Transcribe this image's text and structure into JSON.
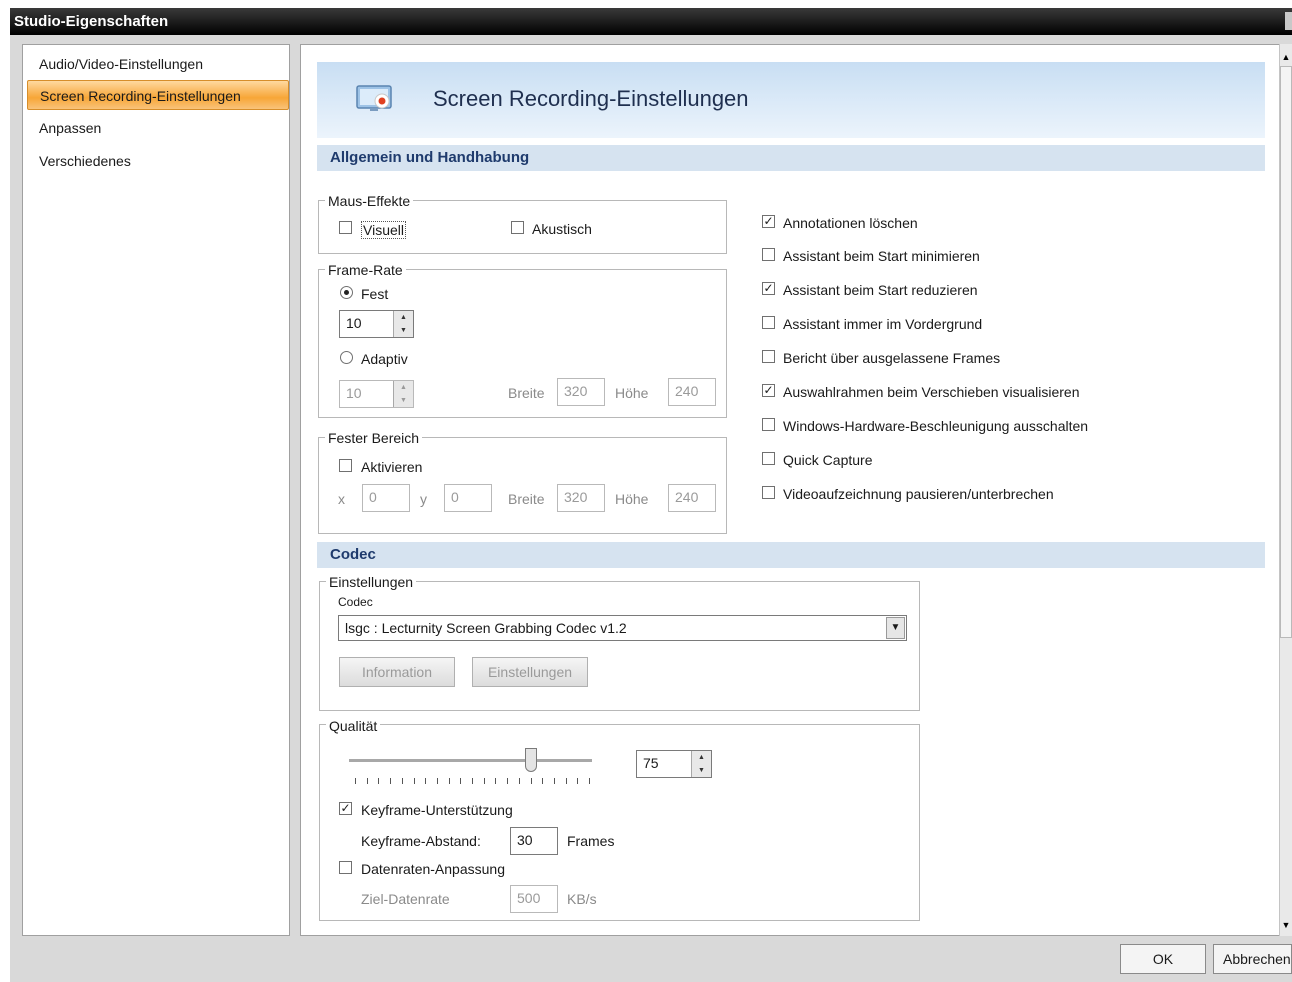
{
  "window": {
    "title": "Studio-Eigenschaften"
  },
  "nav": {
    "items": [
      {
        "label": "Audio/Video-Einstellungen",
        "selected": false
      },
      {
        "label": "Screen Recording-Einstellungen",
        "selected": true
      },
      {
        "label": "Anpassen",
        "selected": false
      },
      {
        "label": "Verschiedenes",
        "selected": false
      }
    ]
  },
  "header": {
    "title": "Screen Recording-Einstellungen",
    "icon": "screen-record-icon"
  },
  "sections": {
    "general": "Allgemein und Handhabung",
    "codec": "Codec"
  },
  "mouse_effects": {
    "legend": "Maus-Effekte",
    "visual_label": "Visuell",
    "visual_checked": false,
    "acoustic_label": "Akustisch",
    "acoustic_checked": false
  },
  "frame_rate": {
    "legend": "Frame-Rate",
    "fixed_label": "Fest",
    "fixed_selected": true,
    "fixed_value": "10",
    "adaptive_label": "Adaptiv",
    "adaptive_selected": false,
    "adaptive_value": "10",
    "width_label": "Breite",
    "width_value": "320",
    "height_label": "Höhe",
    "height_value": "240"
  },
  "fixed_area": {
    "legend": "Fester Bereich",
    "activate_label": "Aktivieren",
    "activate_checked": false,
    "x_label": "x",
    "x_value": "0",
    "y_label": "y",
    "y_value": "0",
    "width_label": "Breite",
    "width_value": "320",
    "height_label": "Höhe",
    "height_value": "240"
  },
  "options": [
    {
      "label": "Annotationen löschen",
      "checked": true
    },
    {
      "label": "Assistant beim Start minimieren",
      "checked": false
    },
    {
      "label": "Assistant beim Start reduzieren",
      "checked": true
    },
    {
      "label": "Assistant immer im Vordergrund",
      "checked": false
    },
    {
      "label": "Bericht über ausgelassene Frames",
      "checked": false
    },
    {
      "label": "Auswahlrahmen beim Verschieben visualisieren",
      "checked": true
    },
    {
      "label": "Windows-Hardware-Beschleunigung ausschalten",
      "checked": false
    },
    {
      "label": "Quick Capture",
      "checked": false
    },
    {
      "label": "Videoaufzeichnung pausieren/unterbrechen",
      "checked": false
    }
  ],
  "codec_settings": {
    "legend": "Einstellungen",
    "codec_label": "Codec",
    "codec_value": "lsgc : Lecturnity Screen Grabbing Codec v1.2",
    "info_button": "Information",
    "settings_button": "Einstellungen"
  },
  "quality": {
    "legend": "Qualität",
    "value": "75",
    "slider_percent": 75,
    "keyframe_label": "Keyframe-Unterstützung",
    "keyframe_checked": true,
    "keyframe_distance_label": "Keyframe-Abstand:",
    "keyframe_distance_value": "30",
    "frames_unit": "Frames",
    "datarate_label": "Datenraten-Anpassung",
    "datarate_checked": false,
    "target_rate_label": "Ziel-Datenrate",
    "target_rate_value": "500",
    "rate_unit": "KB/s"
  },
  "footer": {
    "ok": "OK",
    "cancel": "Abbrechen"
  }
}
